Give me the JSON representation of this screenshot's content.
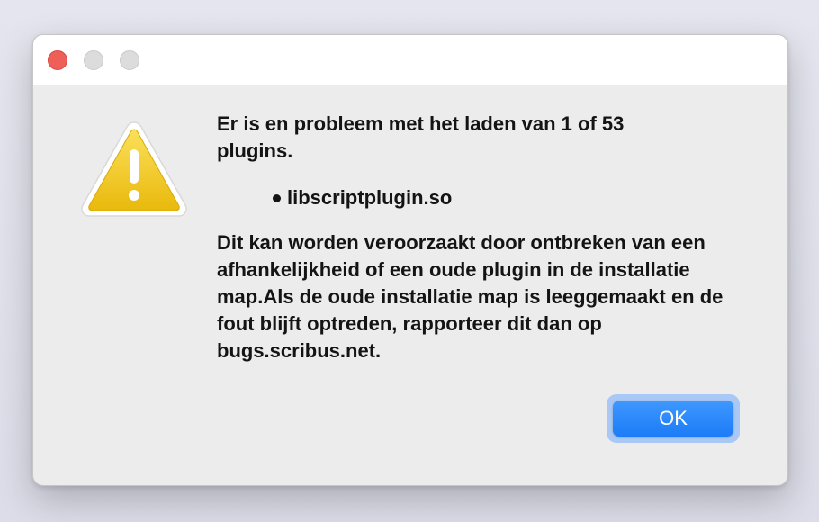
{
  "dialog": {
    "headline": "Er is en probleem met het laden van 1 of 53 plugins.",
    "failed_plugins": [
      "libscriptplugin.so"
    ],
    "detail": "Dit kan worden veroorzaakt door ontbreken van een afhankelijkheid of een oude plugin in de installatie map.Als de oude installatie map is leeggemaakt en de fout blijft optreden, rapporteer dit dan op bugs.scribus.net.",
    "icon": "warning-triangle-icon",
    "ok_label": "OK"
  },
  "colors": {
    "accent": "#1c7cf7",
    "warning": "#f2c518",
    "close_button": "#ee5f58"
  }
}
